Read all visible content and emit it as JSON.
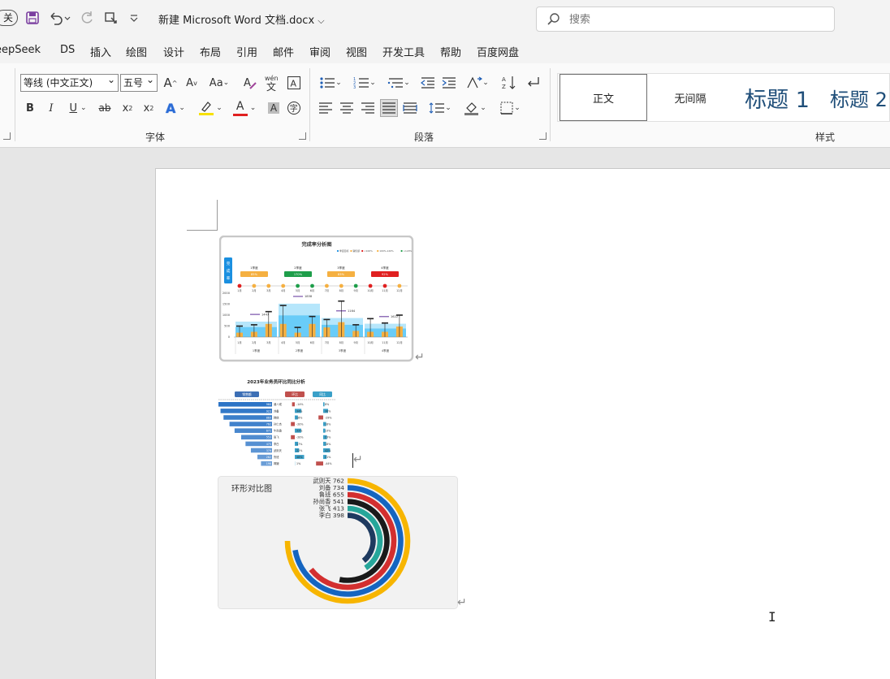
{
  "titlebar": {
    "toggle_label": "关",
    "document_title": "新建 Microsoft Word 文档.docx",
    "search_placeholder": "搜索"
  },
  "menu": [
    "eepSeek",
    "DS",
    "插入",
    "绘图",
    "设计",
    "布局",
    "引用",
    "邮件",
    "审阅",
    "视图",
    "开发工具",
    "帮助",
    "百度网盘"
  ],
  "ribbon": {
    "font_name": "等线 (中文正文)",
    "font_size": "五号",
    "group_font": "字体",
    "group_paragraph": "段落",
    "group_styles": "样式",
    "btn_grow": "A",
    "btn_shrink": "A",
    "btn_case": "Aa",
    "btn_bold": "B",
    "btn_italic": "I",
    "btn_underline": "U",
    "btn_strike": "ab",
    "btn_sub": "x",
    "btn_sup": "x",
    "btn_texteffect": "A",
    "btn_fontcolor": "A",
    "btn_shade": "A",
    "phonetic": "wén 文",
    "styles": [
      "正文",
      "无间隔",
      "标题 1",
      "标题 2"
    ]
  },
  "chart1": {
    "title": "完成率分析图",
    "legend": [
      "季度目标",
      "销售额",
      "<100%",
      "100%-120%",
      ">120%"
    ],
    "side_label": "完成率",
    "quarters": [
      {
        "name": "1季度",
        "pct": "85%",
        "color": "#f5b041"
      },
      {
        "name": "2季度",
        "pct": "170%",
        "color": "#1e9e4a"
      },
      {
        "name": "3季度",
        "pct": "83%",
        "color": "#f5b041"
      },
      {
        "name": "4季度",
        "pct": "92%",
        "color": "#e02020"
      }
    ],
    "months": [
      "1月",
      "2月",
      "3月",
      "4月",
      "5月",
      "6月",
      "7月",
      "8月",
      "9月",
      "10月",
      "11月",
      "12月"
    ],
    "month_dots": [
      "#e02020",
      "#f5b041",
      "#f5b041",
      "#f5b041",
      "#1e9e4a",
      "#1e9e4a",
      "#f5b041",
      "#f5b041",
      "#1e9e4a",
      "#e02020",
      "#e02020",
      "#f5b041"
    ],
    "yticks": [
      "2000",
      "1500",
      "1000",
      "500",
      "0"
    ],
    "quarter_totals": [
      "1447",
      "1858",
      "1164",
      "1622"
    ],
    "quarter_targets": [
      0.35,
      0.76,
      0.43,
      0.3
    ],
    "month_values": [
      0.1,
      0.12,
      0.3,
      0.3,
      0.1,
      0.3,
      0.22,
      0.34,
      0.14,
      0.12,
      0.12,
      0.24
    ],
    "month_targets": [
      0.25,
      0.28,
      0.58,
      0.72,
      0.22,
      0.47,
      0.4,
      0.82,
      0.28,
      0.42,
      0.32,
      0.5
    ],
    "xgroups": [
      "1季度",
      "2季度",
      "3季度",
      "4季度"
    ]
  },
  "chart2": {
    "title": "2023年业务员环比同比分析",
    "headers": [
      "销售额",
      "环比",
      "同比"
    ],
    "rows": [
      {
        "name": "诸八戒",
        "sales": 960,
        "mom": "-14%",
        "yoy": "8%"
      },
      {
        "name": "刘备",
        "sales": 923,
        "mom": "34%",
        "yoy": "30%"
      },
      {
        "name": "韩信",
        "sales": 869,
        "mom": "16%",
        "yoy": "-29%"
      },
      {
        "name": "孙仁杰",
        "sales": 762,
        "mom": "-20%",
        "yoy": "18%"
      },
      {
        "name": "牛尚香",
        "sales": 671,
        "mom": "33%",
        "yoy": "13%"
      },
      {
        "name": "张飞",
        "sales": 553,
        "mom": "-20%",
        "yoy": "23%"
      },
      {
        "name": "李白",
        "sales": 475,
        "mom": "17%",
        "yoy": "18%"
      },
      {
        "name": "武则天",
        "sales": 379,
        "mom": "22%",
        "yoy": "42%"
      },
      {
        "name": "鲁班",
        "sales": 262,
        "mom": "48%",
        "yoy": "21%"
      },
      {
        "name": "嫦娥",
        "sales": 198,
        "mom": "1%",
        "yoy": "-44%"
      }
    ]
  },
  "chart3": {
    "title": "环形对比图",
    "rings": [
      {
        "name": "武则天",
        "value": 762,
        "color": "#f7b500"
      },
      {
        "name": "刘备",
        "value": 734,
        "color": "#1565c0"
      },
      {
        "name": "鲁班",
        "value": 655,
        "color": "#d32f2f"
      },
      {
        "name": "孙尚香",
        "value": 541,
        "color": "#1a1a1a"
      },
      {
        "name": "张飞",
        "value": 413,
        "color": "#26a69a"
      },
      {
        "name": "李白",
        "value": 398,
        "color": "#1e3a5f"
      }
    ]
  },
  "para_mark": "↵",
  "cursor_glyph": "I"
}
